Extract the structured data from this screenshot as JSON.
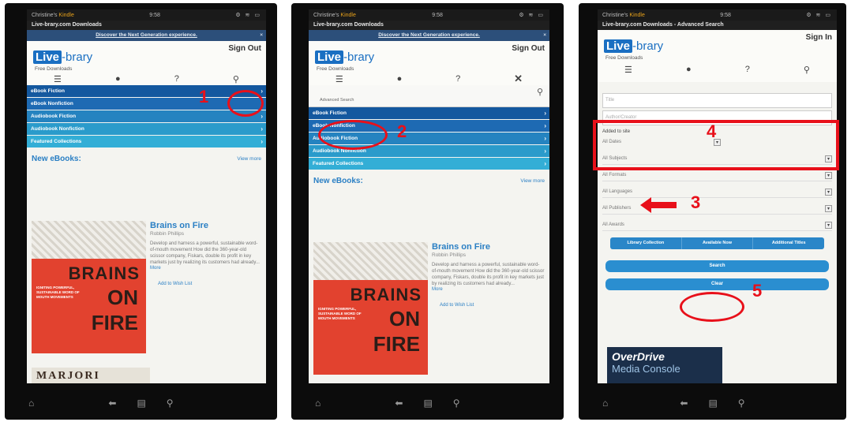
{
  "status": {
    "carrier": "Christine's",
    "carrier_brand": "Kindle",
    "time": "9:58",
    "icons": "⚙ ≋ ▭"
  },
  "panel1": {
    "title": "Live-brary.com Downloads",
    "promo": "Discover the Next Generation experience.",
    "sign": "Sign Out",
    "logo_live": "Live",
    "logo_brary": "-brary",
    "free": "Free Downloads",
    "nav": [
      "eBook Fiction",
      "eBook Nonfiction",
      "Audiobook Fiction",
      "Audiobook Nonfiction",
      "Featured Collections"
    ],
    "new_ebooks": "New eBooks:",
    "view_more": "View more",
    "book_title": "Brains on Fire",
    "book_author": "Robbin Phillips",
    "book_desc": "Develop and harness a powerful, sustainable word-of-mouth movement How did the 360-year-old scissor company, Fiskars, double its profit in key markets just by realizing its customers had already...",
    "more": "More",
    "wish": "Add to Wish List",
    "cover_big": "BRAINS",
    "cover_on": "ON",
    "cover_fire": "FIRE",
    "cover_sub": "IGNITING POWERFUL, SUSTAINABLE WORD OF MOUTH MOVEMENTS",
    "next_cover": "MARJORI",
    "annot": "1"
  },
  "panel2": {
    "title": "Live-brary.com Downloads",
    "promo": "Discover the Next Generation experience.",
    "sign": "Sign Out",
    "logo_live": "Live",
    "logo_brary": "-brary",
    "free": "Free Downloads",
    "advanced": "Advanced Search",
    "nav": [
      "eBook Fiction",
      "eBook Nonfiction",
      "Audiobook Fiction",
      "Audiobook Nonfiction",
      "Featured Collections"
    ],
    "new_ebooks": "New eBooks:",
    "view_more": "View more",
    "book_title": "Brains on Fire",
    "book_author": "Robbin Phillips",
    "book_desc": "Develop and harness a powerful, sustainable word-of-mouth movement How did the 360-year-old scissor company, Fiskars, double its profit in key markets just by realizing its customers had already...",
    "more": "More",
    "wish": "Add to Wish List",
    "cover_big": "BRAINS",
    "cover_on": "ON",
    "cover_fire": "FIRE",
    "cover_sub": "IGNITING POWERFUL, SUSTAINABLE WORD OF MOUTH MOVEMENTS",
    "annot": "2"
  },
  "panel3": {
    "title": "Live-brary.com Downloads - Advanced Search",
    "sign": "Sign In",
    "logo_live": "Live",
    "logo_brary": "-brary",
    "free": "Free Downloads",
    "title_ph": "Title",
    "author_ph": "Author/Creator",
    "added_label": "Added to site",
    "selects": [
      "All Dates",
      "All Subjects",
      "All Formats",
      "All Languages",
      "All Publishers",
      "All Awards"
    ],
    "tabs": [
      "Library Collection",
      "Available Now",
      "Additional Titles"
    ],
    "search": "Search",
    "clear": "Clear",
    "overdrive1": "OverDrive",
    "overdrive2": "Media Console",
    "annot3": "3",
    "annot4": "4",
    "annot5": "5"
  },
  "colors": {
    "annotation_red": "#e8101a",
    "brand_blue": "#1a6fc2"
  },
  "icons": [
    "menu-icon",
    "person-icon",
    "help-icon",
    "search-icon",
    "close-icon",
    "home-icon",
    "back-icon",
    "menu-grid-icon"
  ]
}
